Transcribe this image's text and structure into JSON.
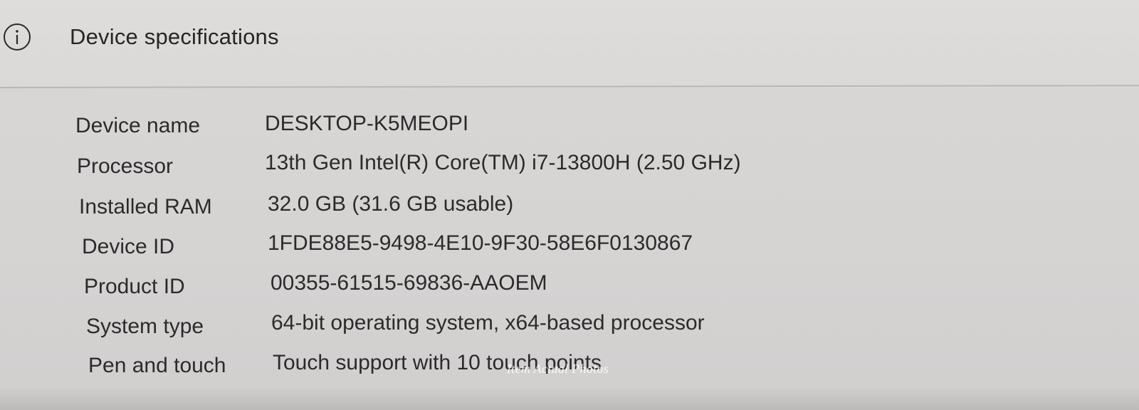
{
  "header": {
    "icon": "info-icon",
    "title": "Device specifications"
  },
  "specs": [
    {
      "label": "Device name",
      "value": "DESKTOP-K5MEOPI"
    },
    {
      "label": "Processor",
      "value": "13th Gen Intel(R) Core(TM) i7-13800H (2.50 GHz)"
    },
    {
      "label": "Installed RAM",
      "value": "32.0 GB (31.6 GB usable)"
    },
    {
      "label": "Device ID",
      "value": "1FDE88E5-9498-4E10-9F30-58E6F0130867"
    },
    {
      "label": "Product ID",
      "value": "00355-61515-69836-AAOEM"
    },
    {
      "label": "System type",
      "value": "64-bit operating system, x64-based processor"
    },
    {
      "label": "Pen and touch",
      "value": "Touch support with 10 touch points"
    }
  ],
  "watermark": "Item Actual Photos",
  "colors": {
    "background": "#d6d4d3",
    "text": "#2a2a2c",
    "divider": "#b9b7b6"
  }
}
